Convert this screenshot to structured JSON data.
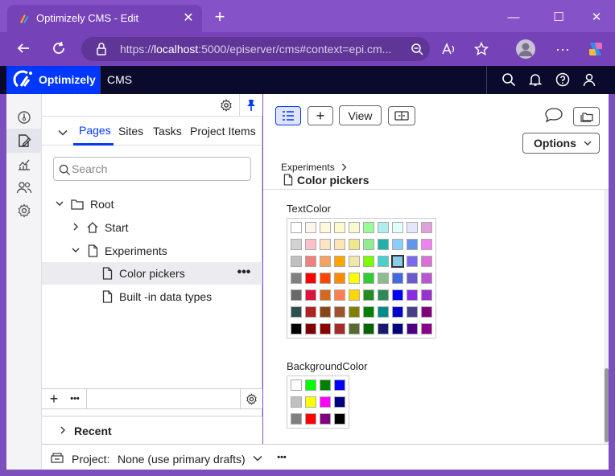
{
  "browser": {
    "tab_title": "Optimizely CMS - Edit",
    "url_host": "https://",
    "url_domain": "localhost",
    "url_rest": ":5000/episerver/cms#context=epi.cm..."
  },
  "header": {
    "logo_text": "Optimizely",
    "product": "CMS"
  },
  "nav": {
    "tabs": [
      {
        "label": "Pages"
      },
      {
        "label": "Sites"
      },
      {
        "label": "Tasks"
      },
      {
        "label": "Project Items"
      }
    ],
    "search_placeholder": "Search",
    "tree": [
      {
        "label": "Root"
      },
      {
        "label": "Start"
      },
      {
        "label": "Experiments"
      },
      {
        "label": "Color pickers"
      },
      {
        "label": "Built -in data types"
      }
    ],
    "recent_label": "Recent"
  },
  "status": {
    "project_label": "Project:",
    "project_value": "None (use primary drafts)"
  },
  "main": {
    "view_button": "View",
    "options_button": "Options",
    "breadcrumb": "Experiments",
    "page_title": "Color pickers",
    "properties": [
      {
        "label": "TextColor",
        "columns": 8,
        "selected_index": 27,
        "colors": [
          "#ffffff",
          "#fcf5ee",
          "#fff8dc",
          "#fffacd",
          "#fafad2",
          "#98fb98",
          "#afeeee",
          "#e0ffff",
          "#e6e6fa",
          "#dda0dd",
          "#d3d3d3",
          "#ffc0cb",
          "#ffe4c4",
          "#ffe4b5",
          "#f0e68c",
          "#90ee90",
          "#20b2aa",
          "#87cefa",
          "#6495ed",
          "#ee82ee",
          "#c0c0c0",
          "#f08080",
          "#f4a460",
          "#ffa500",
          "#eee8aa",
          "#7cfc00",
          "#48d1cc",
          "#87ceeb",
          "#7b68ee",
          "#da70d6",
          "#808080",
          "#ff0000",
          "#ff4500",
          "#ff8c00",
          "#ffff00",
          "#32cd32",
          "#8fbc8f",
          "#4169e1",
          "#6a5acd",
          "#ba55d3",
          "#696969",
          "#dc143c",
          "#d2691e",
          "#ff7f50",
          "#ffd700",
          "#228b22",
          "#2e8b57",
          "#0000ff",
          "#8a2be2",
          "#9932cc",
          "#2f4f4f",
          "#b22222",
          "#8b4513",
          "#a0522d",
          "#808000",
          "#008000",
          "#008b8b",
          "#0000cd",
          "#483d8b",
          "#800080",
          "#000000",
          "#800000",
          "#8b0000",
          "#a52a2a",
          "#556b2f",
          "#006400",
          "#191970",
          "#000080",
          "#4b0082",
          "#8b008b"
        ]
      },
      {
        "label": "BackgroundColor",
        "columns": 4,
        "selected_index": -1,
        "colors": [
          "#ffffff",
          "#00ff00",
          "#008000",
          "#0000ff",
          "#c0c0c0",
          "#ffff00",
          "#ff00ff",
          "#000080",
          "#808080",
          "#ff0000",
          "#800080",
          "#000000"
        ]
      }
    ]
  }
}
